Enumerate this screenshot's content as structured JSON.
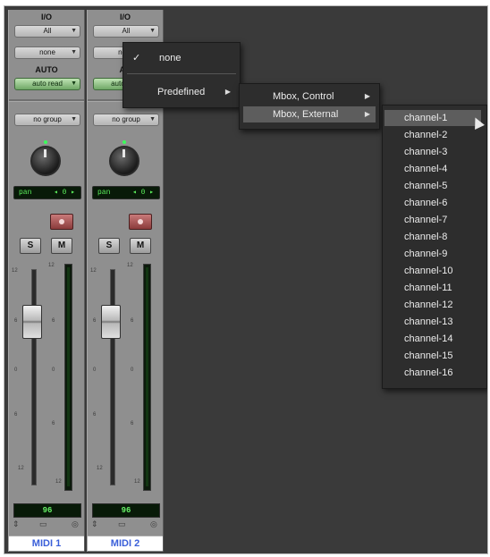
{
  "strips": [
    {
      "io_label": "I/O",
      "input": "All",
      "output": "none",
      "auto_label": "AUTO",
      "auto_mode": "auto read",
      "group": "no group",
      "pan_label": "pan",
      "pan_value": "0",
      "solo": "S",
      "mute": "M",
      "scale_labels": [
        "12",
        "6",
        "0",
        "6",
        "12",
        "12",
        "6",
        "0",
        "6",
        "12"
      ],
      "volume": "96",
      "name": "MIDI 1"
    },
    {
      "io_label": "I/O",
      "input": "All",
      "output": "none",
      "auto_label": "AU",
      "auto_mode": "auto read",
      "group": "no group",
      "pan_label": "pan",
      "pan_value": "0",
      "solo": "S",
      "mute": "M",
      "scale_labels": [
        "12",
        "6",
        "0",
        "6",
        "12",
        "12",
        "6",
        "0",
        "6",
        "12"
      ],
      "volume": "96",
      "name": "MIDI 2"
    }
  ],
  "menu_root": {
    "none": "none",
    "check": "✓",
    "predefined": "Predefined"
  },
  "menu_predefined": {
    "items": [
      "Mbox, Control",
      "Mbox, External"
    ],
    "highlighted": "Mbox, External"
  },
  "menu_channels": {
    "items": [
      "channel-1",
      "channel-2",
      "channel-3",
      "channel-4",
      "channel-5",
      "channel-6",
      "channel-7",
      "channel-8",
      "channel-9",
      "channel-10",
      "channel-11",
      "channel-12",
      "channel-13",
      "channel-14",
      "channel-15",
      "channel-16"
    ],
    "highlighted": "channel-1"
  },
  "colors": {
    "window_bg": "#3a3a3a",
    "strip_bg": "#8f8f8f",
    "menu_bg": "#2d2d2d",
    "menu_highlight": "#5d5d5d",
    "name_text": "#3a5fd9",
    "green_display": "#5cf05c"
  }
}
